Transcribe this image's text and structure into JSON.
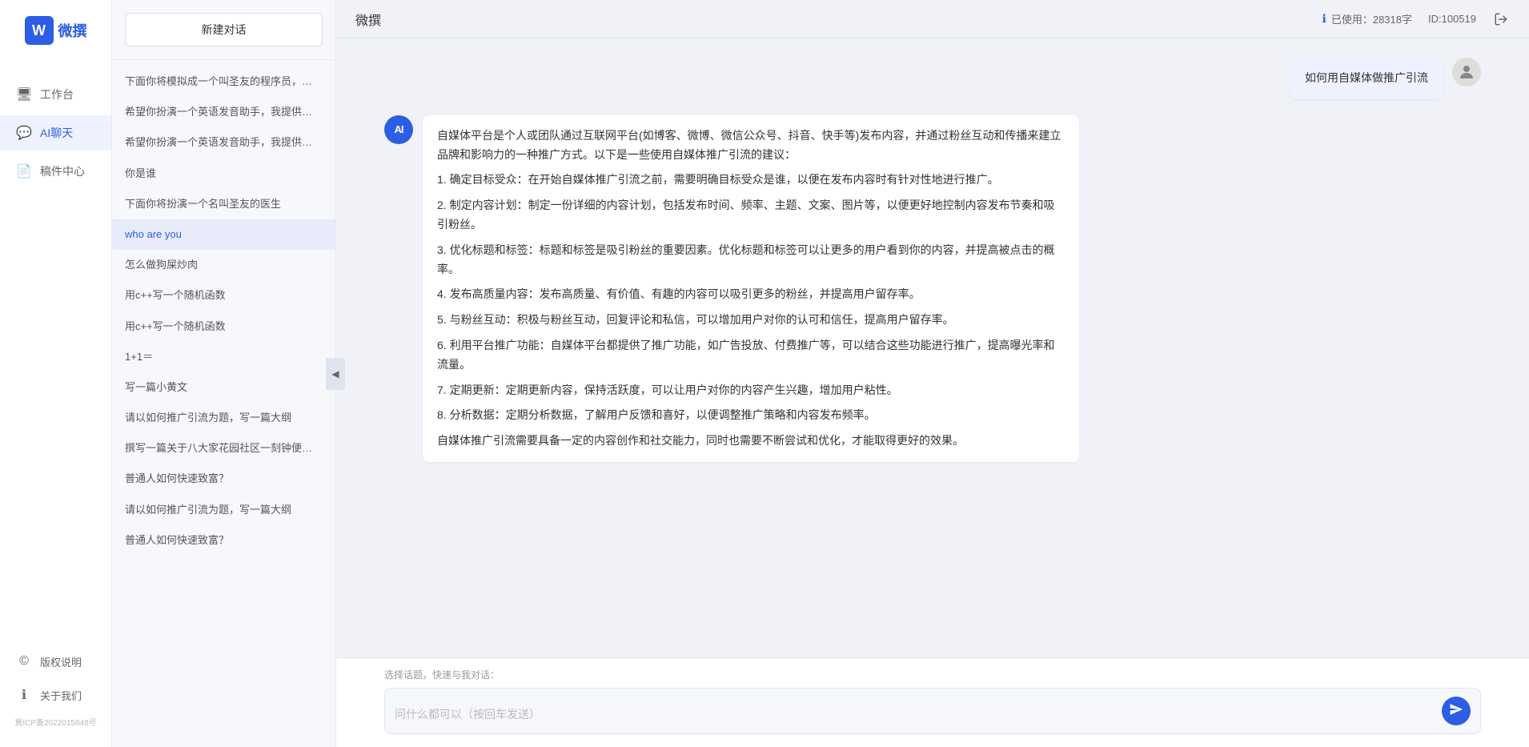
{
  "app": {
    "name": "微撰",
    "logo_letter": "W"
  },
  "topbar": {
    "title": "微撰",
    "usage_label": "已使用：28318字",
    "usage_icon": "info-icon",
    "id_label": "ID:100519"
  },
  "nav": {
    "items": [
      {
        "id": "workspace",
        "label": "工作台",
        "icon": "🖥"
      },
      {
        "id": "ai-chat",
        "label": "AI聊天",
        "icon": "💬",
        "active": true
      },
      {
        "id": "email",
        "label": "稿件中心",
        "icon": "📄"
      }
    ],
    "footer_items": [
      {
        "id": "copyright",
        "label": "版权说明",
        "icon": "©"
      },
      {
        "id": "about",
        "label": "关于我们",
        "icon": "ℹ"
      }
    ],
    "icp": "冀ICP备2022015848号"
  },
  "sidebar": {
    "new_chat_label": "新建对话",
    "chat_list": [
      {
        "id": 1,
        "text": "下面你将模拟成一个叫圣友的程序员，我说..."
      },
      {
        "id": 2,
        "text": "希望你扮演一个英语发音助手，我提供给你..."
      },
      {
        "id": 3,
        "text": "希望你扮演一个英语发音助手，我提供给你..."
      },
      {
        "id": 4,
        "text": "你是谁"
      },
      {
        "id": 5,
        "text": "下面你将扮演一个名叫圣友的医生"
      },
      {
        "id": 6,
        "text": "who are you",
        "active": true
      },
      {
        "id": 7,
        "text": "怎么做狗屎炒肉"
      },
      {
        "id": 8,
        "text": "用c++写一个随机函数"
      },
      {
        "id": 9,
        "text": "用c++写一个随机函数"
      },
      {
        "id": 10,
        "text": "1+1＝"
      },
      {
        "id": 11,
        "text": "写一篇小黄文"
      },
      {
        "id": 12,
        "text": "请以如何推广引流为题，写一篇大纲"
      },
      {
        "id": 13,
        "text": "撰写一篇关于八大家花园社区一刻钟便民生..."
      },
      {
        "id": 14,
        "text": "普通人如何快速致富？"
      },
      {
        "id": 15,
        "text": "请以如何推广引流为题，写一篇大纲"
      },
      {
        "id": 16,
        "text": "普通人如何快速致富？"
      }
    ]
  },
  "chat": {
    "messages": [
      {
        "id": 1,
        "role": "user",
        "text": "如何用自媒体做推广引流"
      },
      {
        "id": 2,
        "role": "assistant",
        "paragraphs": [
          "自媒体平台是个人或团队通过互联网平台(如博客、微博、微信公众号、抖音、快手等)发布内容，并通过粉丝互动和传播来建立品牌和影响力的一种推广方式。以下是一些使用自媒体推广引流的建议：",
          "1. 确定目标受众：在开始自媒体推广引流之前，需要明确目标受众是谁，以便在发布内容时有针对性地进行推广。",
          "2. 制定内容计划：制定一份详细的内容计划，包括发布时间、频率、主题、文案、图片等，以便更好地控制内容发布节奏和吸引粉丝。",
          "3. 优化标题和标签：标题和标签是吸引粉丝的重要因素。优化标题和标签可以让更多的用户看到你的内容，并提高被点击的概率。",
          "4. 发布高质量内容：发布高质量、有价值、有趣的内容可以吸引更多的粉丝，并提高用户留存率。",
          "5. 与粉丝互动：积极与粉丝互动，回复评论和私信，可以增加用户对你的认可和信任，提高用户留存率。",
          "6. 利用平台推广功能：自媒体平台都提供了推广功能，如广告投放、付费推广等，可以结合这些功能进行推广，提高曝光率和流量。",
          "7. 定期更新：定期更新内容，保持活跃度，可以让用户对你的内容产生兴趣，增加用户粘性。",
          "8. 分析数据：定期分析数据，了解用户反馈和喜好，以便调整推广策略和内容发布频率。",
          "自媒体推广引流需要具备一定的内容创作和社交能力，同时也需要不断尝试和优化，才能取得更好的效果。"
        ]
      }
    ],
    "input_placeholder": "问什么都可以（按回车发送）",
    "quick_topics_label": "选择话题，快速与我对话："
  }
}
